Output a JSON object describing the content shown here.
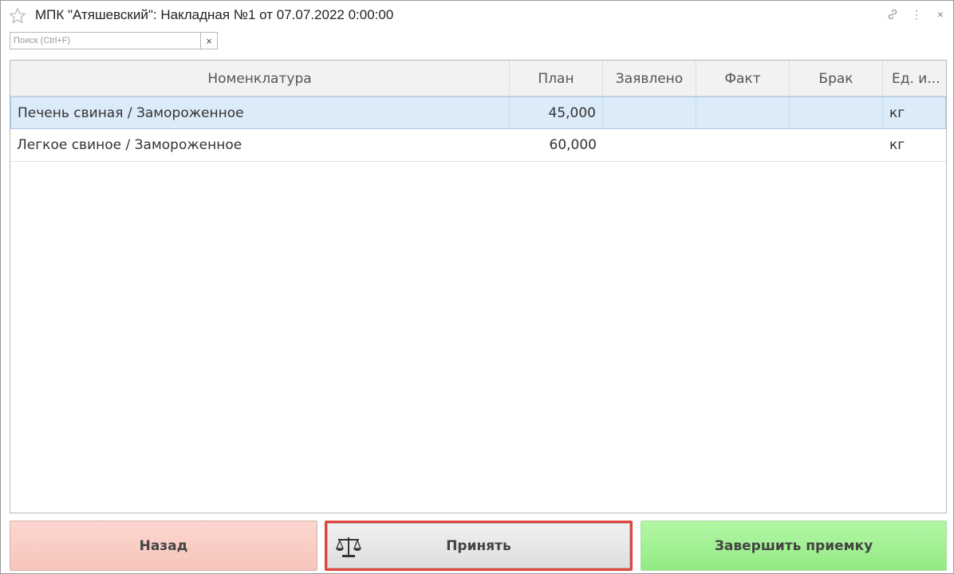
{
  "window": {
    "title": "МПК \"Атяшевский\": Накладная №1 от 07.07.2022 0:00:00",
    "icons": [
      "star-icon",
      "link-icon",
      "more-icon",
      "close-icon"
    ],
    "close_glyph": "×",
    "more_glyph": "⋮"
  },
  "search": {
    "placeholder": "Поиск (Ctrl+F)",
    "value": "",
    "clear_glyph": "×"
  },
  "table": {
    "columns": [
      "Номенклатура",
      "План",
      "Заявлено",
      "Факт",
      "Брак",
      "Ед. и..."
    ],
    "rows": [
      {
        "name": "Печень свиная / Замороженное",
        "plan": "45,000",
        "declared": "",
        "fact": "",
        "defect": "",
        "unit": "кг",
        "selected": true
      },
      {
        "name": "Легкое свиное / Замороженное",
        "plan": "60,000",
        "declared": "",
        "fact": "",
        "defect": "",
        "unit": "кг",
        "selected": false
      }
    ]
  },
  "buttons": {
    "back": "Назад",
    "accept": "Принять",
    "finish": "Завершить приемку"
  },
  "colors": {
    "back_bg": "#f9cec6",
    "accept_border": "#e0443a",
    "finish_bg": "#a3f196",
    "selected_row": "#dcebf8"
  }
}
